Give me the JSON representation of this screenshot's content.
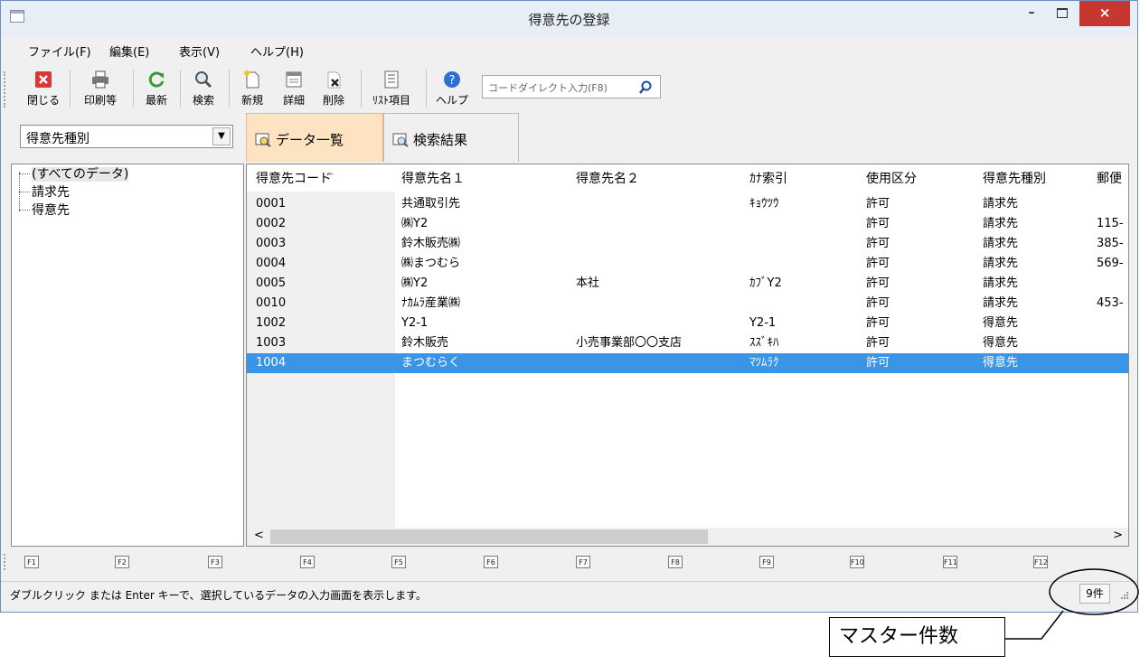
{
  "window": {
    "title": "得意先の登録",
    "close_glyph": "×"
  },
  "menu": [
    "ファイル(F)",
    "編集(E)",
    "表示(V)",
    "ヘルプ(H)"
  ],
  "toolbar": {
    "close": "閉じる",
    "print": "印刷等",
    "refresh": "最新",
    "search": "検索",
    "new": "新規",
    "detail": "詳細",
    "delete": "削除",
    "list_items": "ﾘｽﾄ項目",
    "help": "ヘルプ",
    "code_input_placeholder": "コードダイレクト入力(F8)"
  },
  "category_combo": {
    "value": "得意先種別"
  },
  "tabs": {
    "data_list": "データ一覧",
    "search_results": "検索結果"
  },
  "tree": {
    "items": [
      "(すべてのデータ)",
      "請求先",
      "得意先"
    ]
  },
  "grid": {
    "columns": [
      "得意先コード",
      "得意先名１",
      "得意先名２",
      "ｶﾅ索引",
      "使用区分",
      "得意先種別",
      "郵便"
    ],
    "rows": [
      [
        "0001",
        "共通取引先",
        "",
        "ｷｮｳﾂｳ",
        "許可",
        "請求先",
        ""
      ],
      [
        "0002",
        "㈱Y2",
        "",
        "",
        "許可",
        "請求先",
        "115-"
      ],
      [
        "0003",
        "鈴木販売㈱",
        "",
        "",
        "許可",
        "請求先",
        "385-"
      ],
      [
        "0004",
        "㈱まつむら",
        "",
        "",
        "許可",
        "請求先",
        "569-"
      ],
      [
        "0005",
        "㈱Y2",
        "本社",
        "ｶﾌﾞY2",
        "許可",
        "請求先",
        ""
      ],
      [
        "0010",
        "ﾅｶﾑﾗ産業㈱",
        "",
        "",
        "許可",
        "請求先",
        "453-"
      ],
      [
        "1002",
        "Y2-1",
        "",
        "Y2-1",
        "許可",
        "得意先",
        ""
      ],
      [
        "1003",
        "鈴木販売",
        "小売事業部〇〇支店",
        "ｽｽﾞｷﾊ",
        "許可",
        "得意先",
        ""
      ],
      [
        "1004",
        "まつむらく",
        "",
        "ﾏﾂﾑﾗｸ",
        "許可",
        "得意先",
        ""
      ]
    ],
    "selected_row": 8
  },
  "function_keys": [
    "F1",
    "F2",
    "F3",
    "F4",
    "F5",
    "F6",
    "F7",
    "F8",
    "F9",
    "F10",
    "F11",
    "F12"
  ],
  "status": {
    "message": "ダブルクリック または Enter キーで、選択しているデータの入力画面を表示します。",
    "count": "9件"
  },
  "annotation": {
    "label": "マスター件数"
  },
  "colors": {
    "selection": "#3a95e6",
    "active_tab": "#fde3c2",
    "close_button": "#c7372f"
  }
}
